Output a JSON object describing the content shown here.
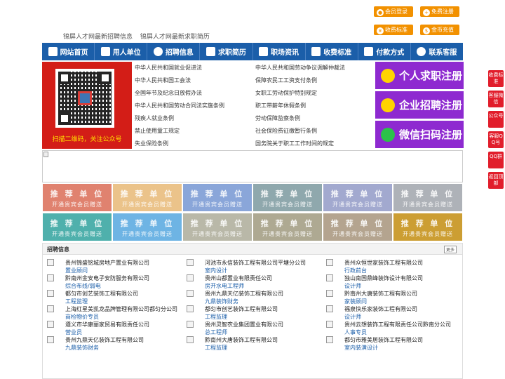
{
  "top_buttons": {
    "member_login": "会员登录",
    "free_register": "免费注册",
    "fee_standard": "收费标准",
    "gold_recharge": "金币充值"
  },
  "tagline": [
    "锦屏人才网最新招聘信息",
    "锦屏人才网最新求职简历"
  ],
  "nav": [
    "网站首页",
    "用人单位",
    "招聘信息",
    "求职简历",
    "职场资讯",
    "收费标准",
    "付款方式",
    "联系客服"
  ],
  "qr_caption": "扫描二维码，关注公众号",
  "law_links_left": [
    "中华人民共和国就业促进法",
    "中华人民共和国工会法",
    "全国年节及纪念日放假办法",
    "中华人民共和国劳动合同法实施条例",
    "残疾人就业条例",
    "禁止使用童工规定",
    "失业保险条例"
  ],
  "law_links_right": [
    "中华人民共和国劳动争议调解仲裁法",
    "保障农民工工资支付条例",
    "女职工劳动保护特别规定",
    "职工带薪年休假条例",
    "劳动保障监察条例",
    "社会保险费征缴暂行条例",
    "国务院关于职工工作时间的规定"
  ],
  "register": {
    "jobseeker": "个人求职注册",
    "company": "企业招聘注册",
    "wechat": "微信扫码注册"
  },
  "recommend": {
    "title": "推 荐 单 位",
    "sub": "开通贵宾会员赠送",
    "colors": [
      "#e0826f",
      "#ebc38a",
      "#8aa6d9",
      "#8fa8ad",
      "#a2a9cf",
      "#aeb2b8",
      "#4fb0ac",
      "#6eb4e4",
      "#b9b8a8",
      "#aea992",
      "#b4a48f",
      "#cc9e33"
    ]
  },
  "jobs": {
    "title": "招聘信息",
    "more": "更多",
    "items": [
      {
        "company": "贵州锦盛铭城房地产置业有限公司",
        "position": "置业顾问"
      },
      {
        "company": "河池市永信装饰工程有限公司平塘分公司",
        "position": "室内设计"
      },
      {
        "company": "贵州众恒世家装饰工程有限公司",
        "position": "行政前台"
      },
      {
        "company": "黔南州金安电子安防服务有限公司",
        "position": "综合布线/弱电"
      },
      {
        "company": "贵州山都置业有限责任公司",
        "position": "房开水电工程师"
      },
      {
        "company": "独山南国鼎峰装饰设计有限公司",
        "position": "设计师"
      },
      {
        "company": "都匀市创艺装饰工程有限公司",
        "position": "工程监理"
      },
      {
        "company": "贵州九鼎天亿装饰工程有限公司",
        "position": "九鼎装饰财务"
      },
      {
        "company": "黔南州大唐装饰工程有限公司",
        "position": "家装顾问"
      },
      {
        "company": "上海红星美凯龙品牌管理有限公司都匀分公司",
        "position": "商检物价专员"
      },
      {
        "company": "都匀市创艺装饰工程有限公司",
        "position": "工程监理"
      },
      {
        "company": "福泉快乐家装饰工程有限公司",
        "position": "设计师"
      },
      {
        "company": "遵义市华康丽家贸易有限责任公司",
        "position": "营业员"
      },
      {
        "company": "贵州灵智农业集团置业有限公司",
        "position": "总工程师"
      },
      {
        "company": "贵州云想装饰工程有限责任公司黔南分公司",
        "position": "人事专员"
      },
      {
        "company": "贵州九鼎天亿装饰工程有限公司",
        "position": "九鼎装饰财务"
      },
      {
        "company": "黔南州大唐装饰工程有限公司",
        "position": "工程监理"
      },
      {
        "company": "都匀市雅美居装饰工程有限公司",
        "position": "室内装潢设计"
      }
    ]
  },
  "side_float": [
    "收费标准",
    "客服微信",
    "公众号",
    "客服QQ号",
    "QQ群",
    "返回顶部"
  ]
}
